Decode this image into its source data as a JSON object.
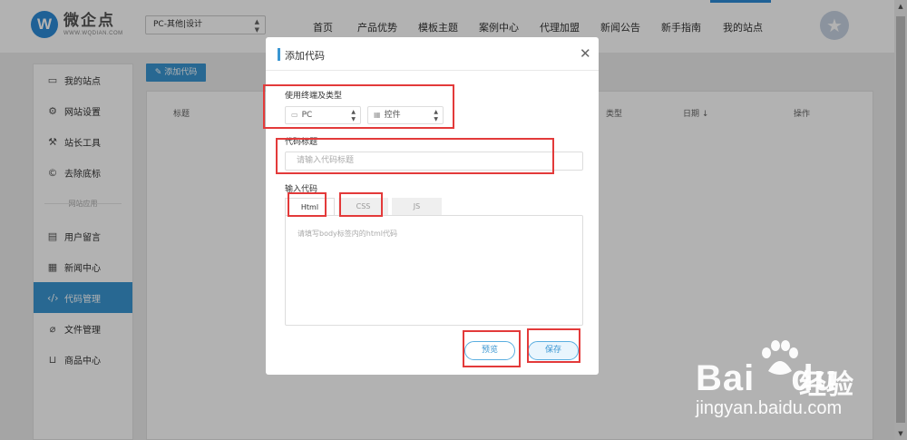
{
  "header": {
    "logo_name": "微企点",
    "logo_url": "WWW.WQDIAN.COM",
    "logo_mark": "W",
    "site_select": "PC-其他|设计",
    "nav": [
      "首页",
      "产品优势",
      "模板主题",
      "案例中心",
      "代理加盟",
      "新闻公告",
      "新手指南",
      "我的站点"
    ],
    "active_nav": "我的站点"
  },
  "sidebar": {
    "items": [
      {
        "label": "我的站点",
        "icon": "monitor-icon"
      },
      {
        "label": "网站设置",
        "icon": "gear-icon"
      },
      {
        "label": "站长工具",
        "icon": "wrench-icon"
      },
      {
        "label": "去除底标",
        "icon": "copyright-icon"
      }
    ],
    "section_label": "网站应用",
    "items2": [
      {
        "label": "用户留言",
        "icon": "message-icon"
      },
      {
        "label": "新闻中心",
        "icon": "news-icon"
      },
      {
        "label": "代码管理",
        "icon": "code-icon"
      },
      {
        "label": "文件管理",
        "icon": "paperclip-icon"
      },
      {
        "label": "商品中心",
        "icon": "cart-icon"
      }
    ],
    "active": "代码管理"
  },
  "main": {
    "add_button": "添加代码",
    "columns": [
      "标题",
      "类型",
      "日期 ↓",
      "操作"
    ]
  },
  "modal": {
    "title": "添加代码",
    "terminal_label": "使用终端及类型",
    "terminal_select": "PC",
    "type_select": "控件",
    "code_title_label": "代码标题",
    "code_title_placeholder": "请输入代码标题",
    "input_code_label": "输入代码",
    "tabs": [
      "Html",
      "CSS",
      "JS"
    ],
    "active_tab": "Html",
    "code_placeholder": "请填写body标签内的html代码",
    "preview_button": "预览",
    "save_button": "保存"
  },
  "watermark": {
    "brand": "Bai",
    "brand_suffix": "du",
    "cn": "经验",
    "url": "jingyan.baidu.com"
  },
  "colors": {
    "accent": "#3a96d2",
    "highlight_box": "#e33a3a"
  }
}
